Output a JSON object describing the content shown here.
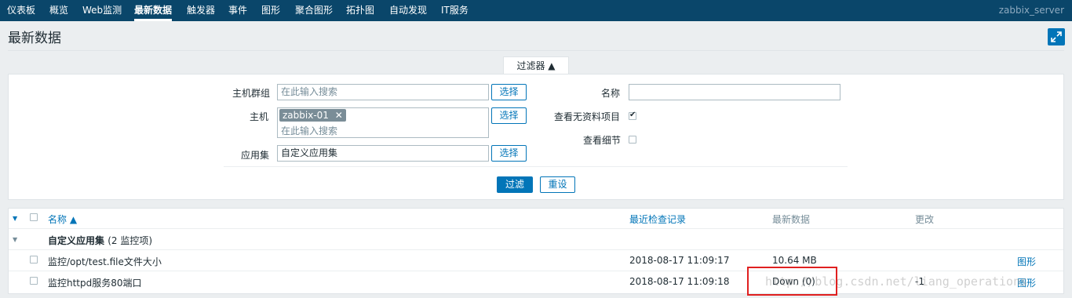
{
  "nav": {
    "items": [
      "仪表板",
      "概览",
      "Web监测",
      "最新数据",
      "触发器",
      "事件",
      "图形",
      "聚合图形",
      "拓扑图",
      "自动发现",
      "IT服务"
    ],
    "active": "最新数据",
    "server": "zabbix_server"
  },
  "page": {
    "title": "最新数据"
  },
  "filter": {
    "tab_label": "过滤器 ▲",
    "host_group_label": "主机群组",
    "host_group_placeholder": "在此输入搜索",
    "host_label": "主机",
    "host_tag": "zabbix-01",
    "host_placeholder": "在此输入搜索",
    "app_label": "应用集",
    "app_value": "自定义应用集",
    "select_label": "选择",
    "name_label": "名称",
    "name_value": "",
    "show_without_data_label": "查看无资料项目",
    "show_without_data_checked": true,
    "show_details_label": "查看细节",
    "show_details_checked": false,
    "apply_label": "过滤",
    "reset_label": "重设"
  },
  "table": {
    "headers": {
      "name": "名称 ▲",
      "last_check": "最近检查记录",
      "last_value": "最新数据",
      "change": "更改"
    },
    "group": {
      "label": "自定义应用集",
      "count": "(2 监控项)"
    },
    "rows": [
      {
        "name": "监控/opt/test.file文件大小",
        "last_check": "2018-08-17 11:09:17",
        "last_value": "10.64 MB",
        "change": "",
        "action": "图形"
      },
      {
        "name": "监控httpd服务80端口",
        "last_check": "2018-08-17 11:09:18",
        "last_value": "Down (0)",
        "change": "-1",
        "action": "图形"
      }
    ]
  },
  "watermark": "http://blog.csdn.net/liang_operations",
  "colors": {
    "nav_bg": "#0a466a",
    "accent": "#0275b8",
    "highlight": "#e02020"
  }
}
